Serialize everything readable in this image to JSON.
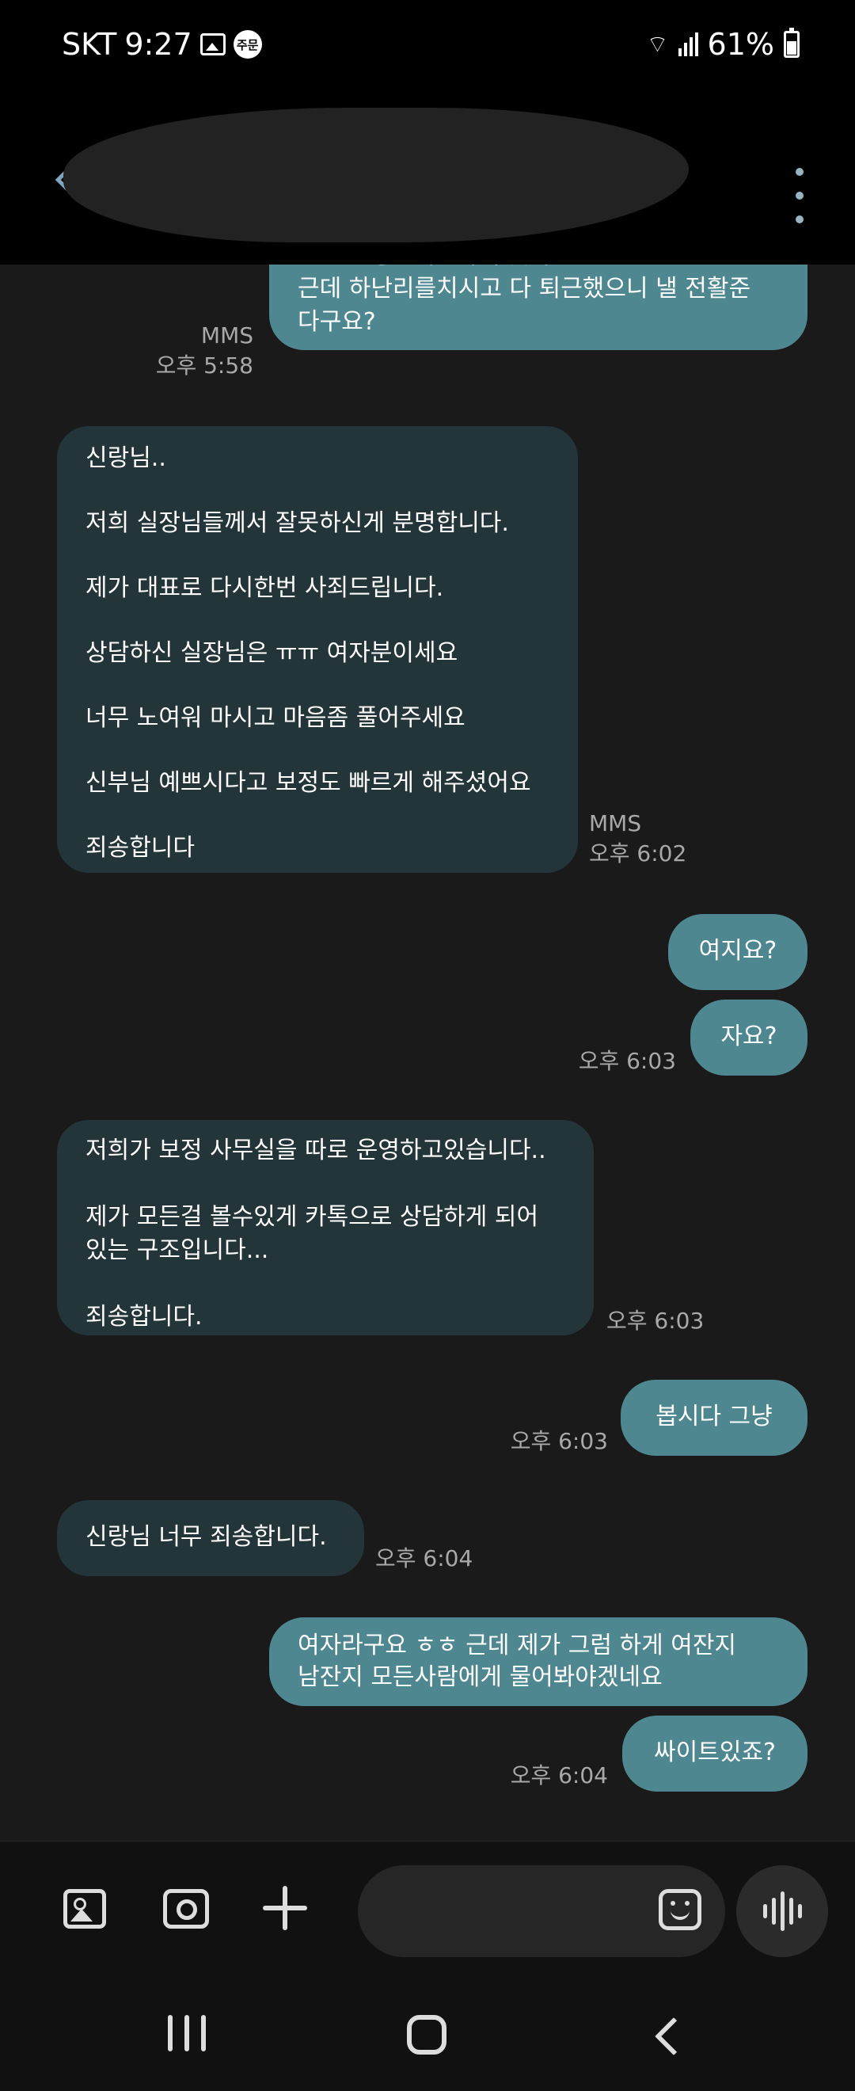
{
  "status_bar": {
    "carrier": "SKT",
    "time": "9:27",
    "badge": "주문",
    "battery": "61%"
  },
  "header": {
    "title": ""
  },
  "messages": [
    {
      "direction": "out",
      "text": "말고 일상셀카? 하거 맞냐요?\n근데 하난리를치시고 다 퇴근했으니 낼 전활준\n다구요?",
      "type": "MMS",
      "time": "오후 5:58"
    },
    {
      "direction": "in",
      "text": "신랑님..\n\n저희 실장님들께서 잘못하신게 분명합니다.\n\n제가 대표로 다시한번 사죄드립니다.\n\n상담하신 실장님은 ㅠㅠ 여자분이세요\n\n너무 노여워 마시고 마음좀 풀어주세요\n\n신부님 예쁘시다고 보정도 빠르게 해주셨어요\n\n죄송합니다",
      "type": "MMS",
      "time": "오후 6:02"
    },
    {
      "direction": "out",
      "text": "여지요?"
    },
    {
      "direction": "out",
      "text": "자요?",
      "time": "오후 6:03"
    },
    {
      "direction": "in",
      "text": "저희가 보정 사무실을 따로 운영하고있습니다..\n\n제가 모든걸 볼수있게 카톡으로 상담하게 되어\n있는 구조입니다...\n\n죄송합니다.",
      "time": "오후 6:03"
    },
    {
      "direction": "out",
      "text": "봅시다 그냥",
      "time": "오후 6:03"
    },
    {
      "direction": "in",
      "text": "신랑님 너무 죄송합니다.",
      "time": "오후 6:04"
    },
    {
      "direction": "out",
      "text": "여자라구요 ㅎㅎ 근데 제가 그럼 하게 여잔지\n남잔지 모든사람에게 물어봐야겠네요"
    },
    {
      "direction": "out",
      "text": "싸이트있죠?",
      "time": "오후 6:04"
    }
  ],
  "composer": {
    "placeholder": ""
  },
  "colors": {
    "incoming_bubble": "#233539",
    "outgoing_bubble": "#4f8790",
    "background": "#1a1a1a"
  }
}
